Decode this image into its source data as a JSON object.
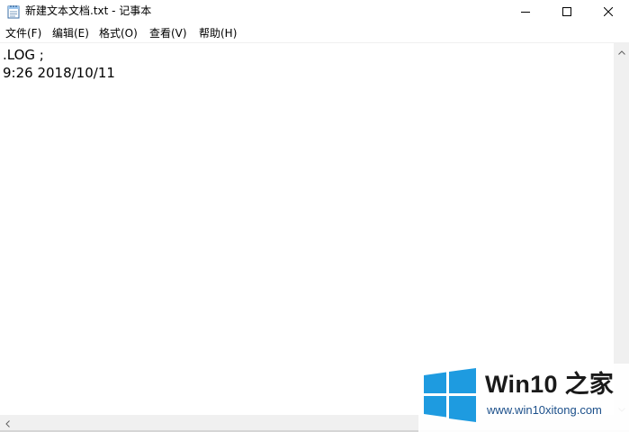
{
  "window": {
    "title": "新建文本文档.txt - 记事本",
    "icon": "notepad-icon"
  },
  "caption_buttons": {
    "minimize_icon": "minimize-icon",
    "maximize_icon": "maximize-icon",
    "close_icon": "close-icon"
  },
  "menubar": {
    "items": [
      {
        "label": "文件(F)"
      },
      {
        "label": "编辑(E)"
      },
      {
        "label": "格式(O)"
      },
      {
        "label": "查看(V)"
      },
      {
        "label": "帮助(H)"
      }
    ]
  },
  "editor": {
    "lines": [
      ".LOG ;",
      "9:26 2018/10/11"
    ]
  },
  "watermark": {
    "title": "Win10 之家",
    "url": "www.win10xitong.com",
    "logo_icon": "windows-logo-icon",
    "colors": {
      "logo": "#1e9be0",
      "title": "#1a1a1a",
      "url": "#1b4f8a"
    }
  }
}
